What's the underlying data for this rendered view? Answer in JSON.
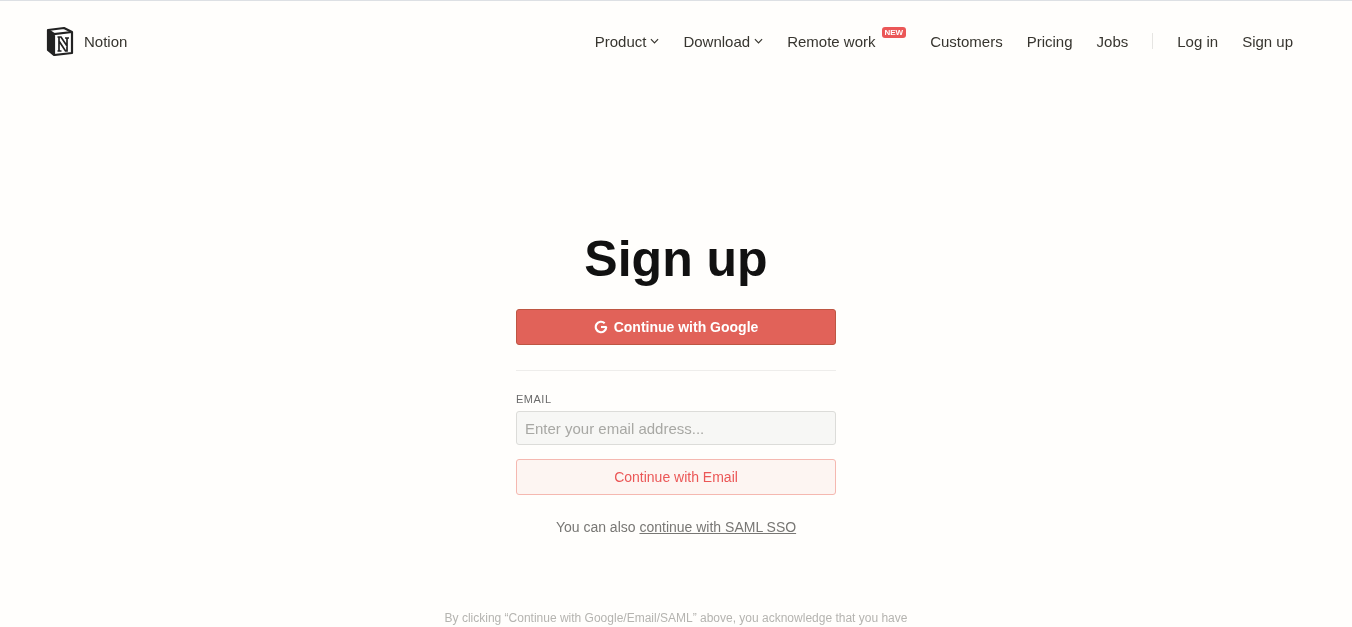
{
  "brand": {
    "name": "Notion"
  },
  "nav": [
    {
      "label": "Product",
      "has_menu": true
    },
    {
      "label": "Download",
      "has_menu": true
    },
    {
      "label": "Remote work",
      "has_menu": false,
      "badge": "NEW"
    },
    {
      "label": "Customers",
      "has_menu": false
    },
    {
      "label": "Pricing",
      "has_menu": false
    },
    {
      "label": "Jobs",
      "has_menu": false
    }
  ],
  "auth_links": [
    "Log in",
    "Sign up"
  ],
  "title": "Sign up",
  "google_button": "Continue with Google",
  "email": {
    "label": "EMAIL",
    "placeholder": "Enter your email address..."
  },
  "email_button": "Continue with Email",
  "sso": {
    "text": "You can also",
    "link": "continue with SAML SSO"
  },
  "legal": "By clicking “Continue with Google/Email/SAML” above, you acknowledge that you have"
}
